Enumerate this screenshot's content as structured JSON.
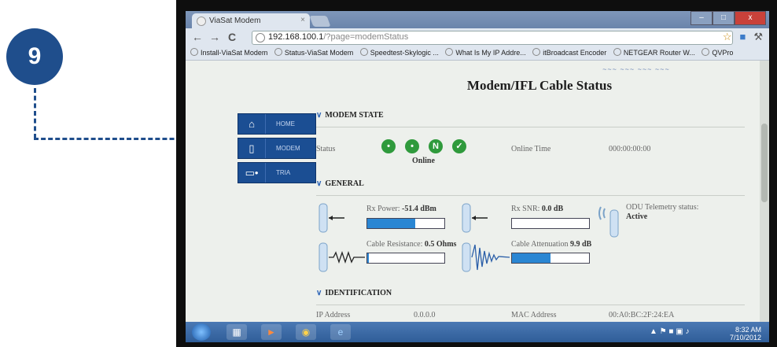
{
  "callout": {
    "number": "9"
  },
  "browser": {
    "tab_title": "ViaSat Modem",
    "tab_close": "×",
    "url_host": "192.168.100.1",
    "url_path": "/?page=modemStatus",
    "window_buttons": {
      "minimize": "–",
      "maximize": "□",
      "close": "x"
    },
    "bookmarks": [
      "Install-ViaSat Modem",
      "Status-ViaSat Modem",
      "Speedtest-Skylogic ...",
      "What Is My IP Addre...",
      "itBroadcast Encoder",
      "NETGEAR Router W...",
      "QVPro"
    ]
  },
  "page": {
    "title": "Modem/IFL Cable Status",
    "header_logos": "~~~ ~~~ ~~~ ~~~",
    "menu": [
      {
        "label": "HOME",
        "icon": "house-icon"
      },
      {
        "label": "MODEM",
        "icon": "modem-icon"
      },
      {
        "label": "TRIA",
        "icon": "antenna-icon"
      }
    ],
    "modem_state": {
      "header": "MODEM STATE",
      "status_label": "Status",
      "status_value": "Online",
      "online_time_label": "Online Time",
      "online_time_value": "000:00:00:00"
    },
    "general": {
      "header": "GENERAL",
      "rx_power_label": "Rx Power:",
      "rx_power_value": "-51.4 dBm",
      "rx_power_level": 0.62,
      "rx_snr_label": "Rx SNR:",
      "rx_snr_value": "0.0 dB",
      "rx_snr_level": 0.0,
      "odu_label": "ODU Telemetry status:",
      "odu_value": "Active",
      "cable_resistance_label": "Cable Resistance:",
      "cable_resistance_value": "0.5 Ohms",
      "cable_resistance_level": 0.02,
      "cable_attenuation_label": "Cable Attenuation",
      "cable_attenuation_value": "9.9 dB",
      "cable_attenuation_level": 0.5
    },
    "identification": {
      "header": "IDENTIFICATION",
      "ip_label": "IP Address",
      "ip_value": "0.0.0.0",
      "mac_label": "MAC Address",
      "mac_value": "00:A0:BC:2F:24:EA"
    }
  },
  "taskbar": {
    "time": "8:32 AM",
    "date": "7/10/2012"
  }
}
